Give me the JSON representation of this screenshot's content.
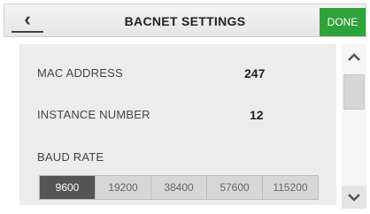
{
  "header": {
    "back_icon": "chevron-left-icon",
    "back_glyph": "‹",
    "title": "BACNET SETTINGS",
    "done_label": "DONE"
  },
  "settings": {
    "mac_address": {
      "label": "MAC ADDRESS",
      "value": "247"
    },
    "instance_number": {
      "label": "INSTANCE NUMBER",
      "value": "12"
    },
    "baud_rate": {
      "label": "BAUD RATE",
      "options": [
        "9600",
        "19200",
        "38400",
        "57600",
        "115200"
      ],
      "selected": "9600"
    }
  },
  "scrollbar": {
    "up_icon": "chevron-up-icon",
    "down_icon": "chevron-down-icon"
  },
  "colors": {
    "done_button": "#2fa23a",
    "selected_segment": "#555555"
  }
}
